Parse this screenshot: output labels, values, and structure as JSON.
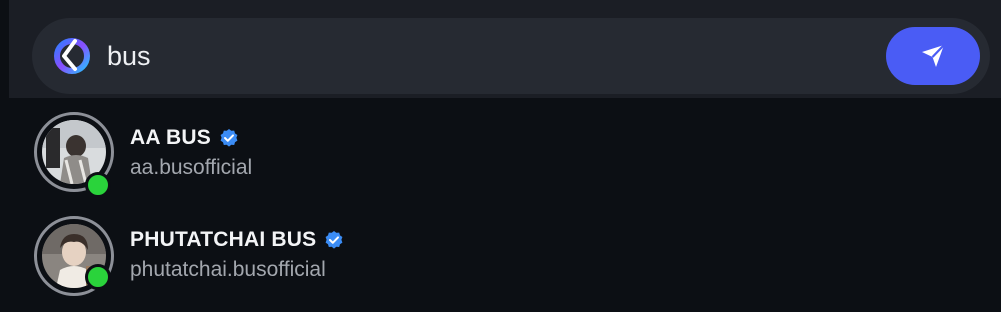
{
  "search": {
    "query": "bus",
    "icon": "meta-ai-icon",
    "send_icon": "send-icon"
  },
  "results": [
    {
      "name": "AA BUS",
      "handle": "aa.busofficial",
      "verified": true,
      "online": true
    },
    {
      "name": "PHUTATCHAI BUS",
      "handle": "phutatchai.busofficial",
      "verified": true,
      "online": true
    }
  ],
  "colors": {
    "background": "#0c0f14",
    "search_bar": "#262a32",
    "accent": "#4a5cf5",
    "verified": "#3b8cf5",
    "online": "#2ad33b"
  }
}
